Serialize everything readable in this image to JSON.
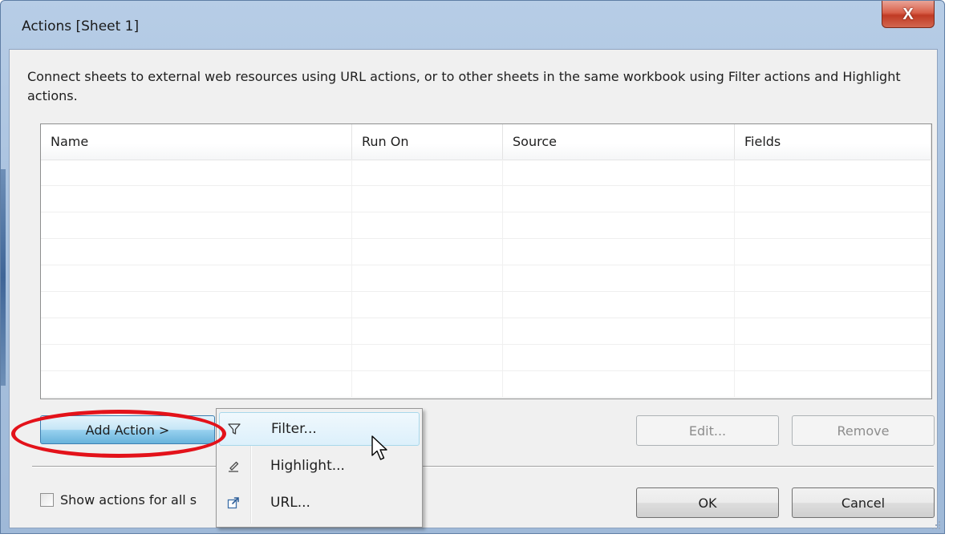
{
  "window": {
    "title": "Actions [Sheet 1]",
    "close_glyph": "X"
  },
  "description": "Connect sheets to external web resources using URL actions, or to other sheets in the same workbook using Filter actions and Highlight actions.",
  "table": {
    "columns": [
      "Name",
      "Run On",
      "Source",
      "Fields"
    ],
    "rows": []
  },
  "buttons": {
    "add_action": "Add Action >",
    "edit": "Edit...",
    "remove": "Remove",
    "ok": "OK",
    "cancel": "Cancel"
  },
  "checkbox": {
    "label": "Show actions for all s",
    "checked": false
  },
  "menu": {
    "items": [
      {
        "label": "Filter...",
        "icon": "filter-icon"
      },
      {
        "label": "Highlight...",
        "icon": "highlighter-icon"
      },
      {
        "label": "URL...",
        "icon": "external-link-icon"
      }
    ],
    "hovered": "Filter..."
  },
  "colors": {
    "annotation_ring": "#e3121a",
    "add_button_accent": "#68b3db",
    "close_button": "#c03a24"
  }
}
